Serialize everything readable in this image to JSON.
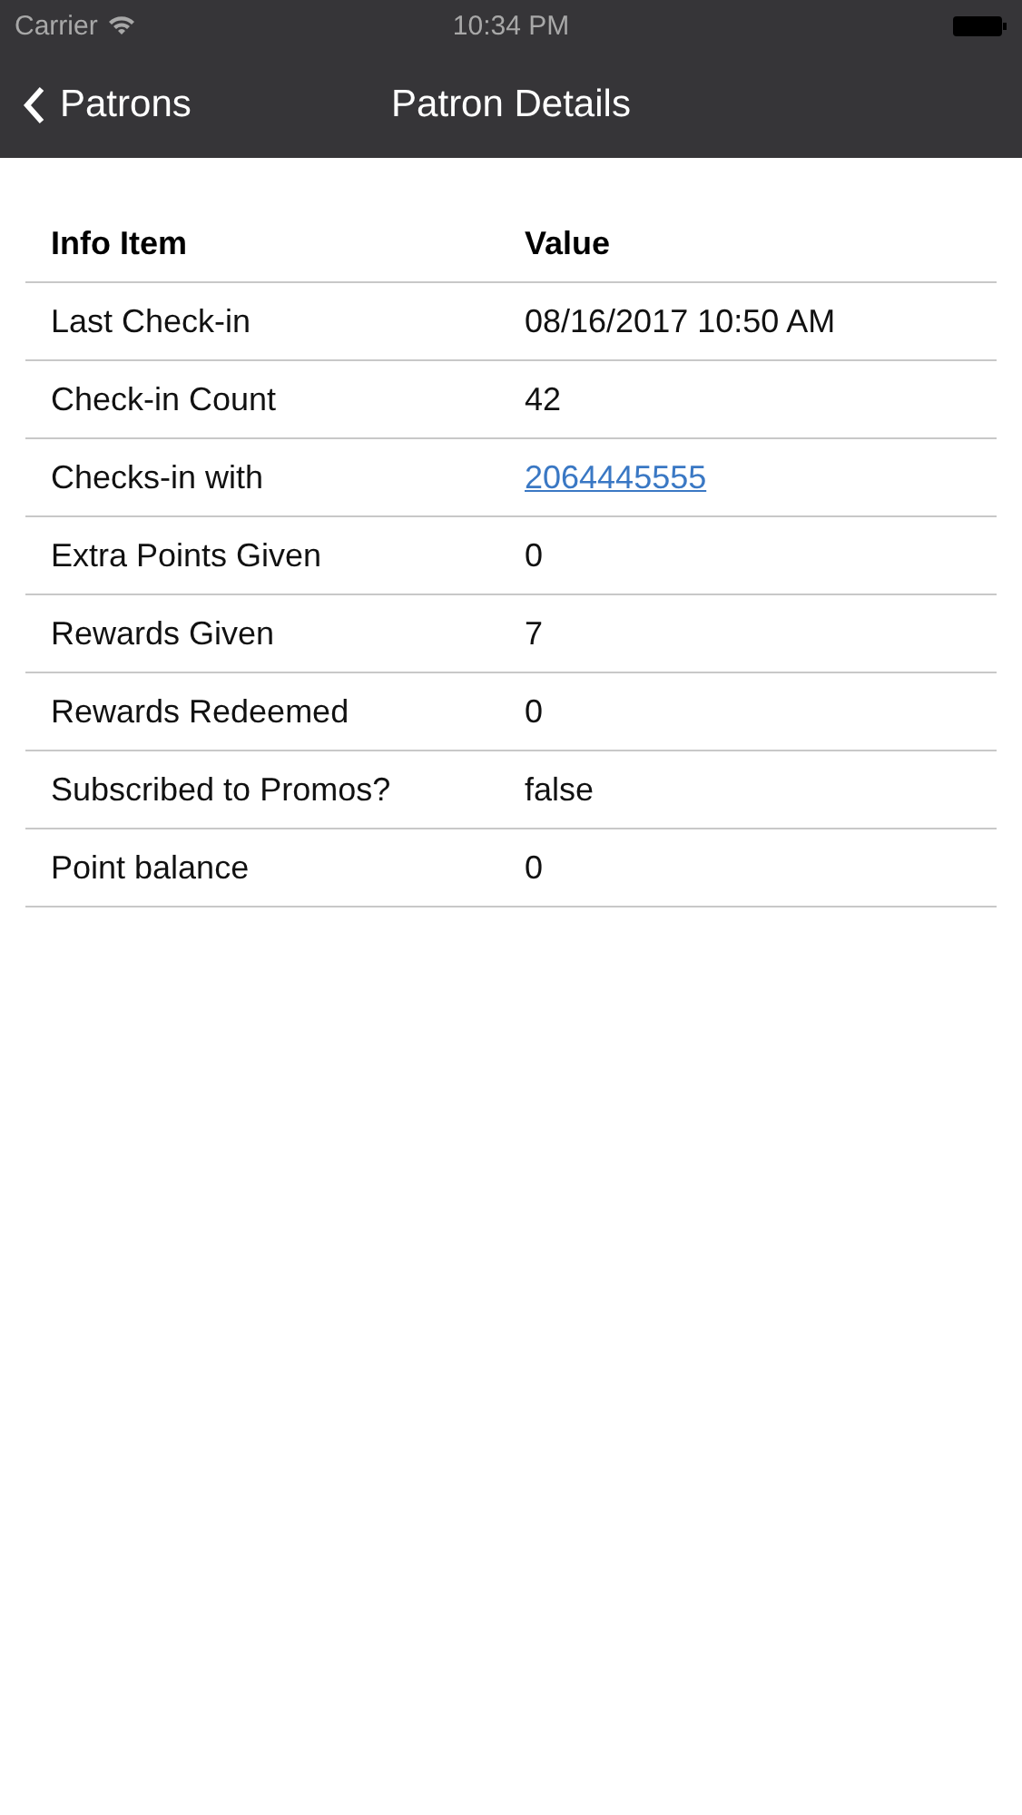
{
  "status_bar": {
    "carrier": "Carrier",
    "time": "10:34 PM"
  },
  "nav_bar": {
    "back_label": "Patrons",
    "title": "Patron Details"
  },
  "table": {
    "columns": [
      "Info Item",
      "Value"
    ],
    "rows": [
      {
        "item": "Last Check-in",
        "value": "08/16/2017 10:50 AM",
        "kind": "text"
      },
      {
        "item": "Check-in Count",
        "value": "42",
        "kind": "text"
      },
      {
        "item": "Checks-in with",
        "value": "2064445555",
        "kind": "link"
      },
      {
        "item": "Extra Points Given",
        "value": "0",
        "kind": "text"
      },
      {
        "item": "Rewards Given",
        "value": "7",
        "kind": "text"
      },
      {
        "item": "Rewards Redeemed",
        "value": "0",
        "kind": "text"
      },
      {
        "item": "Subscribed to Promos?",
        "value": "false",
        "kind": "text"
      },
      {
        "item": "Point balance",
        "value": "0",
        "kind": "text"
      }
    ]
  }
}
